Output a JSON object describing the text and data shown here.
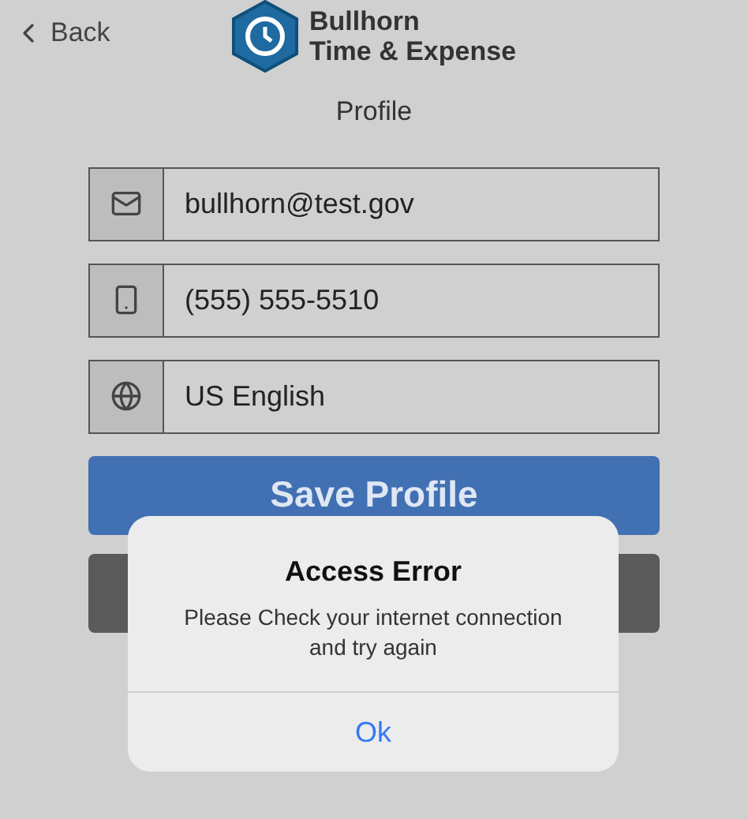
{
  "header": {
    "back": "Back",
    "app_name_line_1": "Bullhorn",
    "app_name_line_2": "Time & Expense",
    "page_title": "Profile"
  },
  "fields": [
    {
      "kind": "email",
      "value": "bullhorn@test.gov"
    },
    {
      "kind": "phone",
      "value": "(555) 555-5510"
    },
    {
      "kind": "language",
      "value": "US English"
    }
  ],
  "save_button": "Save Profile",
  "alert": {
    "title": "Access Error",
    "message": "Please Check your internet connection and try again",
    "button": "Ok"
  }
}
